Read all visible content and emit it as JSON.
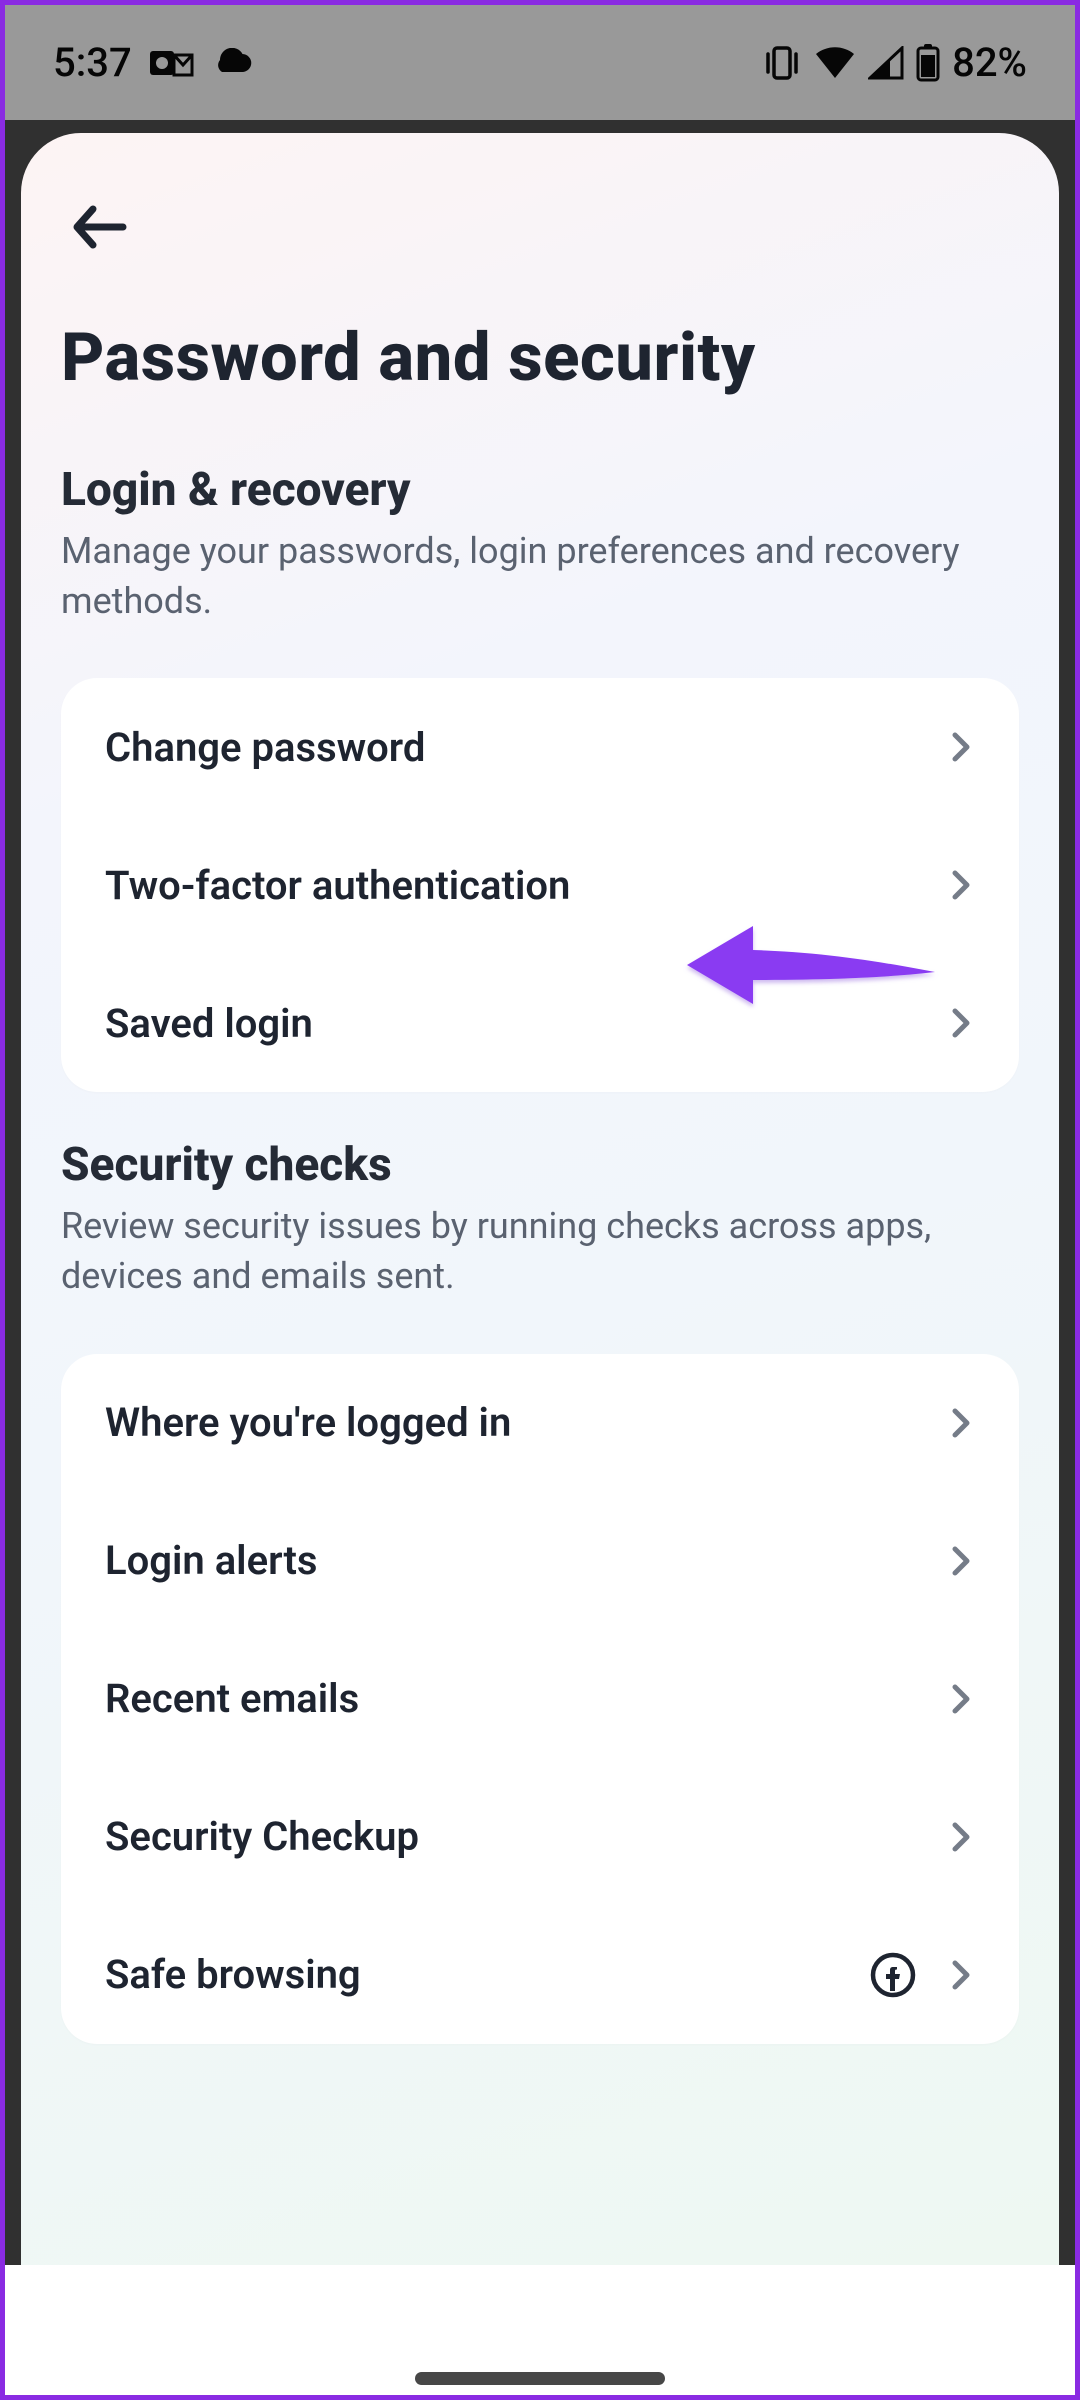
{
  "status": {
    "time": "5:37",
    "battery_text": "82%"
  },
  "page": {
    "title": "Password and security"
  },
  "sections": [
    {
      "title": "Login & recovery",
      "description": "Manage your passwords, login preferences and recovery methods.",
      "items": [
        {
          "label": "Change password"
        },
        {
          "label": "Two-factor authentication"
        },
        {
          "label": "Saved login"
        }
      ]
    },
    {
      "title": "Security checks",
      "description": "Review security issues by running checks across apps, devices and emails sent.",
      "items": [
        {
          "label": "Where you're logged in"
        },
        {
          "label": "Login alerts"
        },
        {
          "label": "Recent emails"
        },
        {
          "label": "Security Checkup"
        },
        {
          "label": "Safe browsing"
        }
      ]
    }
  ],
  "annotation": {
    "arrow_color": "#8a3af2"
  }
}
